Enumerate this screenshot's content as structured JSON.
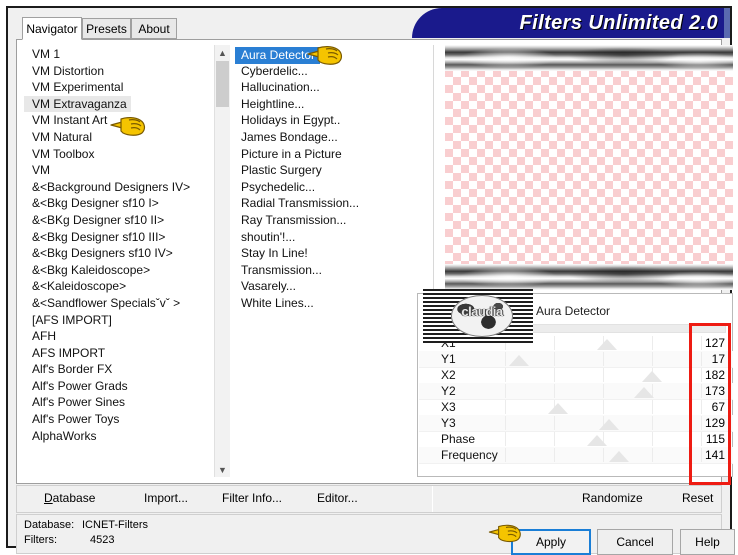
{
  "window": {
    "title": "Filters Unlimited 2.0"
  },
  "tabs": [
    {
      "label": "Navigator",
      "active": true
    },
    {
      "label": "Presets",
      "active": false
    },
    {
      "label": "About",
      "active": false
    }
  ],
  "navigator": {
    "categories": [
      "VM 1",
      "VM Distortion",
      "VM Experimental",
      "VM Extravaganza",
      "VM Instant Art",
      "VM Natural",
      "VM Toolbox",
      "VM",
      "&<Background Designers IV>",
      "&<Bkg Designer sf10 I>",
      "&<BKg Designer sf10 II>",
      "&<Bkg Designer sf10 III>",
      "&<Bkg Designers sf10 IV>",
      "&<Bkg Kaleidoscope>",
      "&<Kaleidoscope>",
      "&<Sandflower Specialsˇvˇ >",
      "[AFS IMPORT]",
      "AFH",
      "AFS IMPORT",
      "Alf's Border FX",
      "Alf's Power Grads",
      "Alf's Power Sines",
      "Alf's Power Toys",
      "AlphaWorks"
    ],
    "selected_category": "VM Extravaganza",
    "scroll_up_icon": "chevron-up-icon",
    "scroll_down_icon": "chevron-down-icon"
  },
  "filters": {
    "items": [
      "Aura Detector",
      "Cyberdelic...",
      "Hallucination...",
      "Heightline...",
      "Holidays in Egypt..",
      "James Bondage...",
      "Picture in a Picture",
      "Plastic Surgery",
      "Psychedelic...",
      "Radial Transmission...",
      "Ray Transmission...",
      "shoutin'!...",
      "Stay In Line!",
      "Transmission...",
      "Vasarely...",
      "White Lines..."
    ],
    "selected": "Aura Detector"
  },
  "preview": {
    "watermark": "claudia"
  },
  "params": {
    "title": "Aura Detector",
    "rows": [
      {
        "label": "X1",
        "value": "127",
        "pos": 52
      },
      {
        "label": "Y1",
        "value": "17",
        "pos": 7
      },
      {
        "label": "X2",
        "value": "182",
        "pos": 75
      },
      {
        "label": "Y2",
        "value": "173",
        "pos": 71
      },
      {
        "label": "X3",
        "value": "67",
        "pos": 27
      },
      {
        "label": "Y3",
        "value": "129",
        "pos": 53
      },
      {
        "label": "Phase",
        "value": "115",
        "pos": 47
      },
      {
        "label": "Frequency",
        "value": "141",
        "pos": 58
      }
    ]
  },
  "commands": {
    "database": "Database",
    "import": "Import...",
    "filter_info": "Filter Info...",
    "editor": "Editor...",
    "randomize": "Randomize",
    "reset": "Reset"
  },
  "status": {
    "database_label": "Database:",
    "database_value": "ICNET-Filters",
    "filters_label": "Filters:",
    "filters_value": "4523"
  },
  "buttons": {
    "apply": "Apply",
    "cancel": "Cancel",
    "help": "Help"
  },
  "colors": {
    "title_bg": "#1a1a8c",
    "selection_blue": "#2a7fd4",
    "highlight_red": "#ee1b12",
    "focus_blue": "#1a7ed6",
    "checker_pink": "#f9ced0"
  },
  "cursors": {
    "pointer_icon": "pointing-hand-icon",
    "count": 3
  }
}
